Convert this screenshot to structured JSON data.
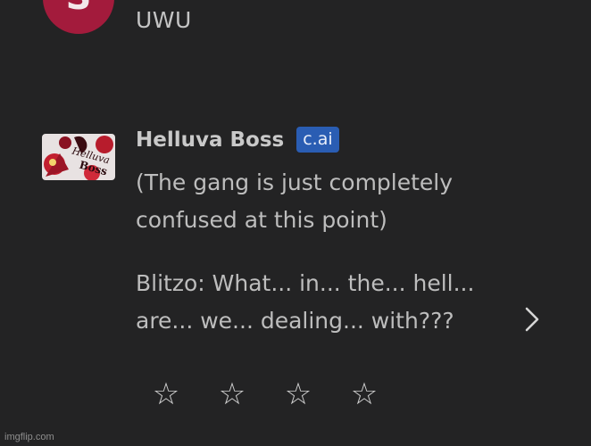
{
  "messages": {
    "user": {
      "avatar_letter": "S",
      "avatar_color": "#a31b3c",
      "text": "UWU"
    },
    "bot": {
      "name": "Helluva Boss",
      "badge": "c.ai",
      "badge_color": "#2a5db3",
      "avatar_icon": "helluva-boss-logo",
      "paragraphs": [
        "(The gang is just completely confused at this point)",
        "Blitzo: What... in... the... hell... are... we... dealing... with???"
      ]
    }
  },
  "controls": {
    "next_icon": "chevron-right-icon",
    "rating_stars": [
      "☆",
      "☆",
      "☆",
      "☆"
    ]
  },
  "watermark": "imgflip.com"
}
